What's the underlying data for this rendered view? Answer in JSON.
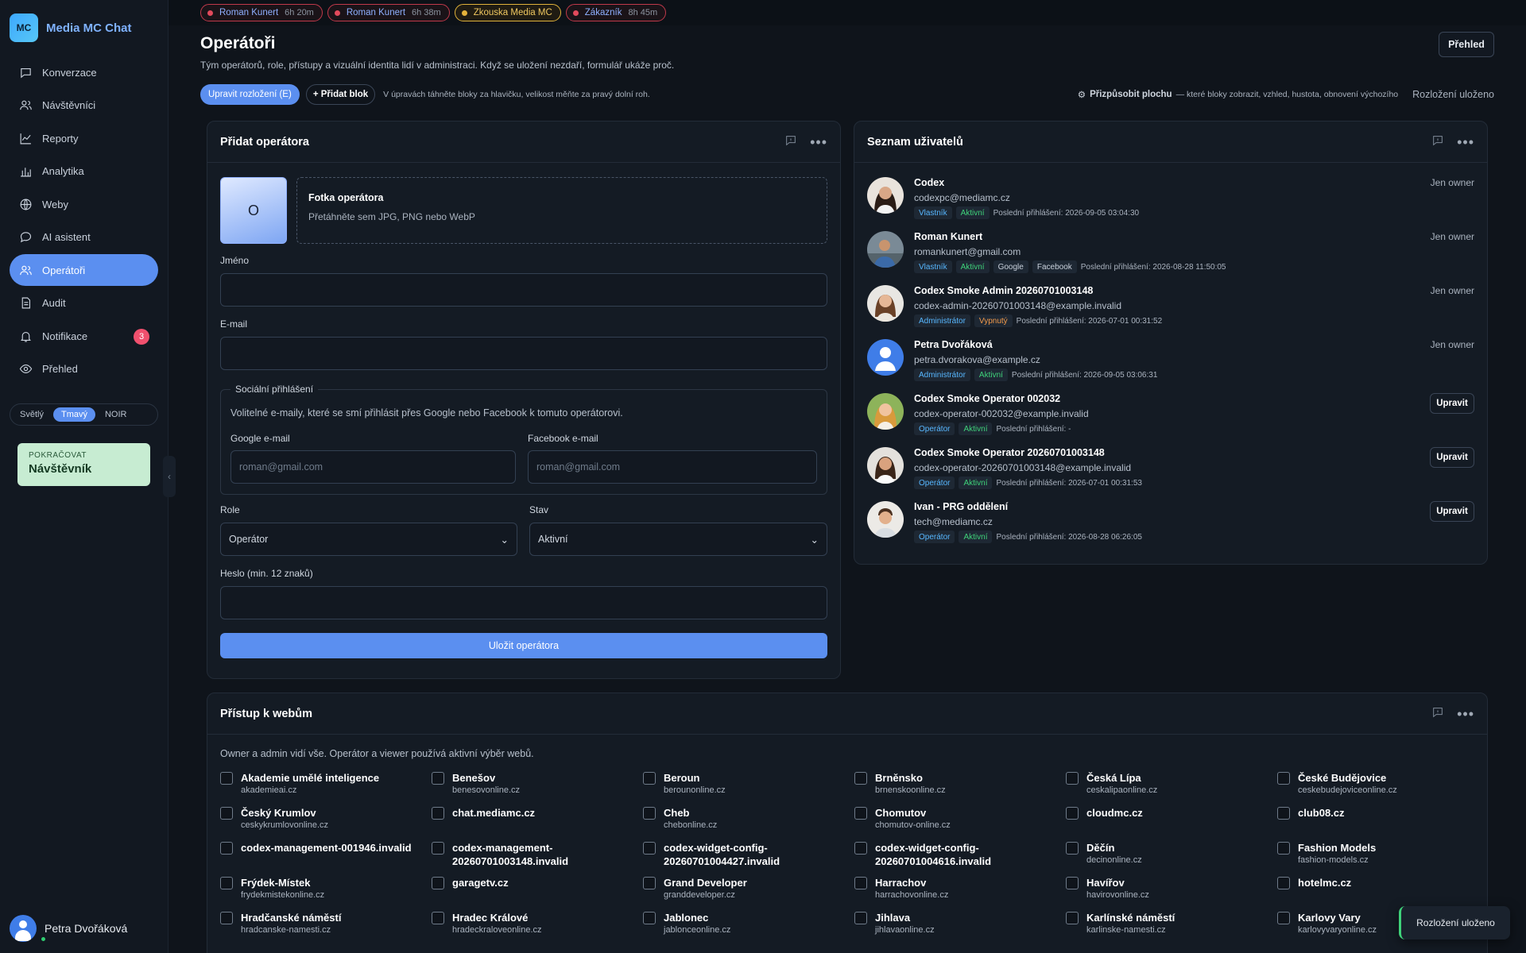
{
  "app": {
    "logo": "MC",
    "name": "Media MC Chat"
  },
  "sidebar": {
    "items": [
      {
        "label": "Konverzace",
        "icon": "chat-bubble-icon"
      },
      {
        "label": "Návštěvníci",
        "icon": "users-icon"
      },
      {
        "label": "Reporty",
        "icon": "line-chart-icon"
      },
      {
        "label": "Analytika",
        "icon": "bar-chart-icon"
      },
      {
        "label": "Weby",
        "icon": "globe-icon"
      },
      {
        "label": "AI asistent",
        "icon": "chat-bubble-icon"
      },
      {
        "label": "Operátoři",
        "icon": "users-icon",
        "active": true
      },
      {
        "label": "Audit",
        "icon": "document-icon"
      },
      {
        "label": "Notifikace",
        "icon": "bell-icon",
        "badge": "3"
      },
      {
        "label": "Přehled",
        "icon": "eye-icon"
      }
    ],
    "theme": {
      "light": "Světlý",
      "dark": "Tmavý",
      "noir": "NOIR",
      "selected": "Tmavý"
    },
    "resume": {
      "kicker": "POKRAČOVAT",
      "title": "Návštěvník"
    },
    "user": {
      "name": "Petra Dvořáková"
    }
  },
  "topbar": {
    "chips": [
      {
        "name": "Roman Kunert",
        "time": "6h 20m",
        "color": "#e24a5c"
      },
      {
        "name": "Roman Kunert",
        "time": "6h 38m",
        "color": "#e24a5c"
      },
      {
        "name": "Zkouska Media MC",
        "time": "",
        "color": "#e5b23a"
      },
      {
        "name": "Zákazník",
        "time": "8h 45m",
        "color": "#e24a5c"
      }
    ]
  },
  "page": {
    "title": "Operátoři",
    "subtitle": "Tým operátorů, role, přístupy a vizuální identita lidí v administraci. Když se uložení nezdaří, formulář ukáže proč.",
    "overview_button": "Přehled",
    "edit_layout": "Upravit rozložení (E)",
    "add_block": "+ Přidat blok",
    "layout_hint": "V úpravách táhněte bloky za hlavičku, velikost měňte za pravý dolní roh.",
    "customize": "Přizpůsobit plochu",
    "customize_desc": "— které bloky zobrazit, vzhled, hustota, obnovení výchozího",
    "layout_saved": "Rozložení uloženo"
  },
  "add_operator": {
    "title": "Přidat operátora",
    "photo_initial": "O",
    "photo_title": "Fotka operátora",
    "photo_hint": "Přetáhněte sem JPG, PNG nebo WebP",
    "name_label": "Jméno",
    "name_value": "",
    "email_label": "E-mail",
    "email_value": "",
    "social_legend": "Sociální přihlášení",
    "social_desc": "Volitelné e-maily, které se smí přihlásit přes Google nebo Facebook k tomuto operátorovi.",
    "google_label": "Google e-mail",
    "google_placeholder": "roman@gmail.com",
    "facebook_label": "Facebook e-mail",
    "facebook_placeholder": "roman@gmail.com",
    "role_label": "Role",
    "role_value": "Operátor",
    "status_label": "Stav",
    "status_value": "Aktivní",
    "password_label": "Heslo (min. 12 znaků)",
    "password_value": "",
    "save_button": "Uložit operátora"
  },
  "users": {
    "title": "Seznam uživatelů",
    "items": [
      {
        "name": "Codex",
        "email": "codexpc@mediamc.cz",
        "role": "Vlastník",
        "status": "Aktivní",
        "socials": [],
        "last_login": "Poslední přihlášení: 2026-09-05 03:04:30",
        "right": "Jen owner",
        "avatar": "woman-dark-hair"
      },
      {
        "name": "Roman Kunert",
        "email": "romankunert@gmail.com",
        "role": "Vlastník",
        "status": "Aktivní",
        "socials": [
          "Google",
          "Facebook"
        ],
        "last_login": "Poslední přihlášení: 2026-08-28 11:50:05",
        "right": "Jen owner",
        "avatar": "man-outdoor"
      },
      {
        "name": "Codex Smoke Admin 20260701003148",
        "email": "codex-admin-20260701003148@example.invalid",
        "role": "Administrátor",
        "status": "Vypnutý",
        "socials": [],
        "last_login": "Poslední přihlášení: 2026-07-01 00:31:52",
        "right": "Jen owner",
        "avatar": "woman-brown-hair"
      },
      {
        "name": "Petra Dvořáková",
        "email": "petra.dvorakova@example.cz",
        "role": "Administrátor",
        "status": "Aktivní",
        "socials": [],
        "last_login": "Poslední přihlášení: 2026-09-05 03:06:31",
        "right": "Jen owner",
        "avatar": "default-user"
      },
      {
        "name": "Codex Smoke Operator 002032",
        "email": "codex-operator-002032@example.invalid",
        "role": "Operátor",
        "status": "Aktivní",
        "socials": [],
        "last_login": "Poslední přihlášení: -",
        "right": "Upravit",
        "avatar": "woman-blonde"
      },
      {
        "name": "Codex Smoke Operator 20260701003148",
        "email": "codex-operator-20260701003148@example.invalid",
        "role": "Operátor",
        "status": "Aktivní",
        "socials": [],
        "last_login": "Poslední přihlášení: 2026-07-01 00:31:53",
        "right": "Upravit",
        "avatar": "woman-smile"
      },
      {
        "name": "Ivan - PRG oddělení",
        "email": "tech@mediamc.cz",
        "role": "Operátor",
        "status": "Aktivní",
        "socials": [],
        "last_login": "Poslední přihlášení: 2026-08-28 06:26:05",
        "right": "Upravit",
        "avatar": "man-smile"
      }
    ]
  },
  "access": {
    "title": "Přístup k webům",
    "intro": "Owner a admin vidí vše. Operátor a viewer používá aktivní výběr webů.",
    "sites": [
      {
        "name": "Akademie umělé inteligence",
        "domain": "akademieai.cz"
      },
      {
        "name": "Benešov",
        "domain": "benesovonline.cz"
      },
      {
        "name": "Beroun",
        "domain": "berounonline.cz"
      },
      {
        "name": "Brněnsko",
        "domain": "brnenskoonline.cz"
      },
      {
        "name": "Česká Lípa",
        "domain": "ceskalipaonline.cz"
      },
      {
        "name": "České Budějovice",
        "domain": "ceskebudejoviceonline.cz"
      },
      {
        "name": "Český Krumlov",
        "domain": "ceskykrumlovonline.cz"
      },
      {
        "name": "chat.mediamc.cz",
        "domain": ""
      },
      {
        "name": "Cheb",
        "domain": "chebonline.cz"
      },
      {
        "name": "Chomutov",
        "domain": "chomutov-online.cz"
      },
      {
        "name": "cloudmc.cz",
        "domain": ""
      },
      {
        "name": "club08.cz",
        "domain": ""
      },
      {
        "name": "codex-management-001946.invalid",
        "domain": ""
      },
      {
        "name": "codex-management-20260701003148.invalid",
        "domain": ""
      },
      {
        "name": "codex-widget-config-20260701004427.invalid",
        "domain": ""
      },
      {
        "name": "codex-widget-config-20260701004616.invalid",
        "domain": ""
      },
      {
        "name": "Děčín",
        "domain": "decinonline.cz"
      },
      {
        "name": "Fashion Models",
        "domain": "fashion-models.cz"
      },
      {
        "name": "Frýdek-Místek",
        "domain": "frydekmistekonline.cz"
      },
      {
        "name": "garagetv.cz",
        "domain": ""
      },
      {
        "name": "Grand Developer",
        "domain": "granddeveloper.cz"
      },
      {
        "name": "Harrachov",
        "domain": "harrachovonline.cz"
      },
      {
        "name": "Havířov",
        "domain": "havirovonline.cz"
      },
      {
        "name": "hotelmc.cz",
        "domain": ""
      },
      {
        "name": "Hradčanské náměstí",
        "domain": "hradcanske-namesti.cz"
      },
      {
        "name": "Hradec Králové",
        "domain": "hradeckraloveonline.cz"
      },
      {
        "name": "Jablonec",
        "domain": "jablonceonline.cz"
      },
      {
        "name": "Jihlava",
        "domain": "jihlavaonline.cz"
      },
      {
        "name": "Karlínské náměstí",
        "domain": "karlinske-namesti.cz"
      },
      {
        "name": "Karlovy Vary",
        "domain": "karlovyvaryonline.cz"
      }
    ]
  },
  "toast": "Rozložení uloženo"
}
